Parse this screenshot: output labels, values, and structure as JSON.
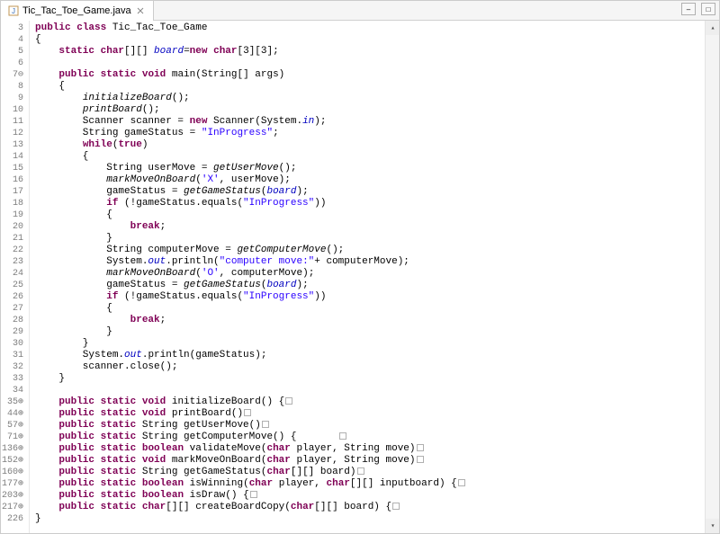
{
  "tab": {
    "filename": "Tic_Tac_Toe_Game.java"
  },
  "window": {
    "minimize": "‒",
    "maximize": "□"
  },
  "code": {
    "lines": [
      {
        "n": "3",
        "fold": "",
        "html": "<span class='kw'>public</span> <span class='kw'>class</span> Tic_Tac_Toe_Game"
      },
      {
        "n": "4",
        "fold": "",
        "html": "{"
      },
      {
        "n": "5",
        "fold": "",
        "html": "    <span class='kw'>static</span> <span class='kw'>char</span>[][] <span class='field'>board</span>=<span class='kw'>new</span> <span class='kw'>char</span>[3][3];"
      },
      {
        "n": "6",
        "fold": "",
        "html": ""
      },
      {
        "n": "7⊖",
        "fold": "",
        "html": "    <span class='kw'>public</span> <span class='kw'>static</span> <span class='kw'>void</span> main(String[] args)"
      },
      {
        "n": "8",
        "fold": "",
        "html": "    {"
      },
      {
        "n": "9",
        "fold": "",
        "html": "        <span class='stat-call'>initializeBoard</span>();"
      },
      {
        "n": "10",
        "fold": "",
        "html": "        <span class='stat-call'>printBoard</span>();"
      },
      {
        "n": "11",
        "fold": "",
        "html": "        Scanner scanner = <span class='kw'>new</span> Scanner(System.<span class='field'>in</span>);"
      },
      {
        "n": "12",
        "fold": "",
        "html": "        String gameStatus = <span class='str'>\"InProgress\"</span>;"
      },
      {
        "n": "13",
        "fold": "",
        "html": "        <span class='kw'>while</span>(<span class='kw'>true</span>)"
      },
      {
        "n": "14",
        "fold": "",
        "html": "        {"
      },
      {
        "n": "15",
        "fold": "",
        "html": "            String userMove = <span class='stat-call'>getUserMove</span>();"
      },
      {
        "n": "16",
        "fold": "",
        "html": "            <span class='stat-call'>markMoveOnBoard</span>(<span class='str'>'X'</span>, userMove);"
      },
      {
        "n": "17",
        "fold": "",
        "html": "            gameStatus = <span class='stat-call'>getGameStatus</span>(<span class='field'>board</span>);"
      },
      {
        "n": "18",
        "fold": "",
        "html": "            <span class='kw'>if</span> (!gameStatus.equals(<span class='str'>\"InProgress\"</span>))"
      },
      {
        "n": "19",
        "fold": "",
        "html": "            {"
      },
      {
        "n": "20",
        "fold": "",
        "html": "                <span class='kw'>break</span>;"
      },
      {
        "n": "21",
        "fold": "",
        "html": "            }"
      },
      {
        "n": "22",
        "fold": "",
        "html": "            String computerMove = <span class='stat-call'>getComputerMove</span>();"
      },
      {
        "n": "23",
        "fold": "",
        "html": "            System.<span class='field'>out</span>.println(<span class='str'>\"computer move:\"</span>+ computerMove);"
      },
      {
        "n": "24",
        "fold": "",
        "html": "            <span class='stat-call'>markMoveOnBoard</span>(<span class='str'>'O'</span>, computerMove);"
      },
      {
        "n": "25",
        "fold": "",
        "html": "            gameStatus = <span class='stat-call'>getGameStatus</span>(<span class='field'>board</span>);"
      },
      {
        "n": "26",
        "fold": "",
        "html": "            <span class='kw'>if</span> (!gameStatus.equals(<span class='str'>\"InProgress\"</span>))"
      },
      {
        "n": "27",
        "fold": "",
        "html": "            {"
      },
      {
        "n": "28",
        "fold": "",
        "html": "                <span class='kw'>break</span>;"
      },
      {
        "n": "29",
        "fold": "",
        "html": "            }"
      },
      {
        "n": "30",
        "fold": "",
        "html": "        }"
      },
      {
        "n": "31",
        "fold": "",
        "html": "        System.<span class='field'>out</span>.println(gameStatus);"
      },
      {
        "n": "32",
        "fold": "",
        "html": "        scanner.close();"
      },
      {
        "n": "33",
        "fold": "",
        "html": "    }"
      },
      {
        "n": "34",
        "fold": "",
        "html": ""
      },
      {
        "n": "35⊕",
        "fold": "",
        "html": "    <span class='kw'>public</span> <span class='kw'>static</span> <span class='kw'>void</span> initializeBoard() {<span class='collapsed-box'></span>"
      },
      {
        "n": "44⊕",
        "fold": "",
        "html": "    <span class='kw'>public</span> <span class='kw'>static</span> <span class='kw'>void</span> printBoard()<span class='collapsed-box'></span>"
      },
      {
        "n": "57⊕",
        "fold": "",
        "html": "    <span class='kw'>public</span> <span class='kw'>static</span> String getUserMove()<span class='collapsed-box'></span>"
      },
      {
        "n": "71⊕",
        "fold": "",
        "html": "    <span class='kw'>public</span> <span class='kw'>static</span> String getComputerMove() {       <span class='collapsed-box'></span>"
      },
      {
        "n": "136⊕",
        "fold": "",
        "html": "    <span class='kw'>public</span> <span class='kw'>static</span> <span class='kw'>boolean</span> validateMove(<span class='kw'>char</span> player, String move)<span class='collapsed-box'></span>"
      },
      {
        "n": "152⊕",
        "fold": "",
        "html": "    <span class='kw'>public</span> <span class='kw'>static</span> <span class='kw'>void</span> markMoveOnBoard(<span class='kw'>char</span> player, String move)<span class='collapsed-box'></span>"
      },
      {
        "n": "160⊕",
        "fold": "",
        "html": "    <span class='kw'>public</span> <span class='kw'>static</span> String getGameStatus(<span class='kw'>char</span>[][] board)<span class='collapsed-box'></span>"
      },
      {
        "n": "177⊕",
        "fold": "",
        "html": "    <span class='kw'>public</span> <span class='kw'>static</span> <span class='kw'>boolean</span> isWinning(<span class='kw'>char</span> player, <span class='kw'>char</span>[][] inputboard) {<span class='collapsed-box'></span>"
      },
      {
        "n": "203⊕",
        "fold": "",
        "html": "    <span class='kw'>public</span> <span class='kw'>static</span> <span class='kw'>boolean</span> isDraw() {<span class='collapsed-box'></span>"
      },
      {
        "n": "217⊕",
        "fold": "",
        "html": "    <span class='kw'>public</span> <span class='kw'>static</span> <span class='kw'>char</span>[][] createBoardCopy(<span class='kw'>char</span>[][] board) {<span class='collapsed-box'></span>"
      },
      {
        "n": "226",
        "fold": "",
        "html": "}"
      }
    ]
  }
}
